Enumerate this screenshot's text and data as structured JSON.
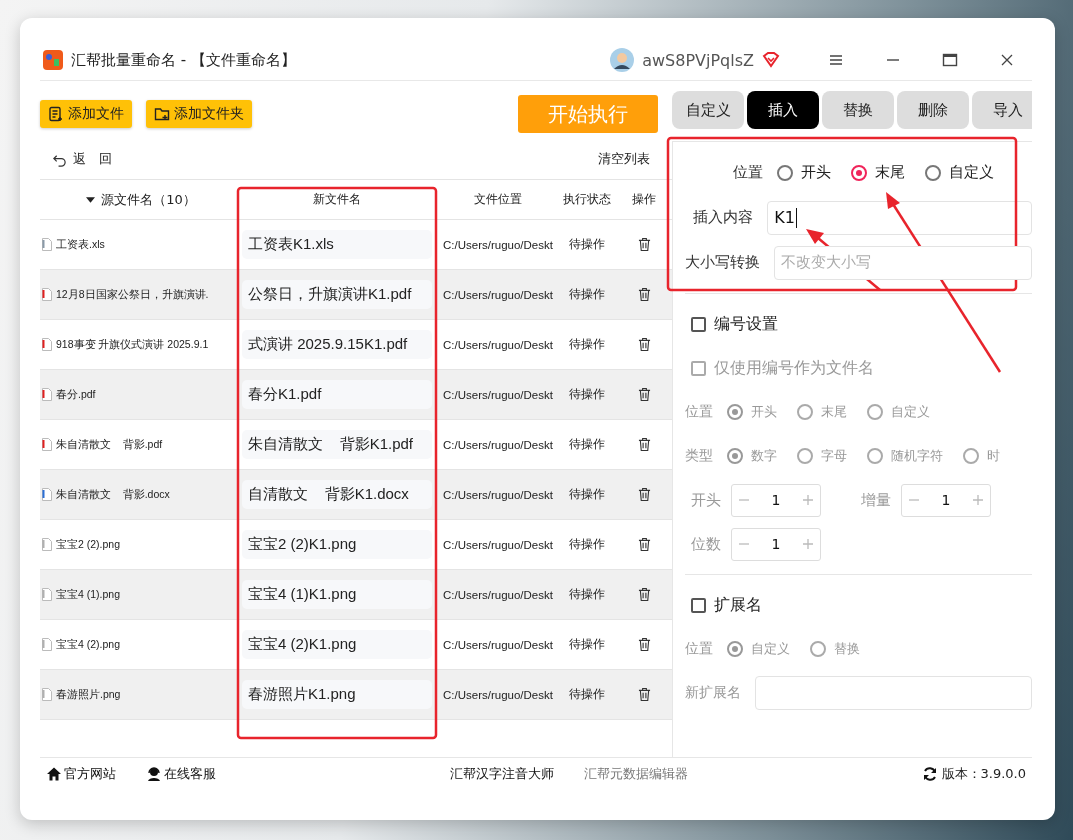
{
  "window": {
    "title": "汇帮批量重命名 - 【文件重命名】",
    "user": "awS8PVjPqlsZ"
  },
  "toolbar": {
    "buttons": [
      {
        "label": "添加文件",
        "kind": "file"
      },
      {
        "label": "添加文件夹",
        "kind": "folder"
      }
    ],
    "start": "开始执行"
  },
  "back": "返　回",
  "clear": "清空列表",
  "table": {
    "columns": [
      "源文件名（10）",
      "新文件名",
      "文件位置",
      "执行状态",
      "操作"
    ],
    "rows": [
      {
        "source": "工资表.xls",
        "new": "工资表K1.xls",
        "location": "C:/Users/ruguo/Deskt",
        "status": "待操作",
        "color": "#8a9aa8"
      },
      {
        "source": "12月8日国家公祭日，升旗演讲.",
        "new": "公祭日，升旗演讲K1.pdf",
        "location": "C:/Users/ruguo/Deskt",
        "status": "待操作",
        "color": "#e02020"
      },
      {
        "source": "918事变 升旗仪式演讲 2025.9.1",
        "new": "式演讲 2025.9.15K1.pdf",
        "location": "C:/Users/ruguo/Deskt",
        "status": "待操作",
        "color": "#e02020"
      },
      {
        "source": "春分.pdf",
        "new": "春分K1.pdf",
        "location": "C:/Users/ruguo/Deskt",
        "status": "待操作",
        "color": "#e02020"
      },
      {
        "source": "朱自清散文    背影.pdf",
        "new": "朱自清散文    背影K1.pdf",
        "location": "C:/Users/ruguo/Deskt",
        "status": "待操作",
        "color": "#e02020"
      },
      {
        "source": "朱自清散文    背影.docx",
        "new": "自清散文    背影K1.docx",
        "location": "C:/Users/ruguo/Deskt",
        "status": "待操作",
        "color": "#2b6fd6"
      },
      {
        "source": "宝宝2 (2).png",
        "new": "宝宝2 (2)K1.png",
        "location": "C:/Users/ruguo/Deskt",
        "status": "待操作",
        "color": "#b0b0b0"
      },
      {
        "source": "宝宝4 (1).png",
        "new": "宝宝4 (1)K1.png",
        "location": "C:/Users/ruguo/Deskt",
        "status": "待操作",
        "color": "#b0b0b0"
      },
      {
        "source": "宝宝4 (2).png",
        "new": "宝宝4 (2)K1.png",
        "location": "C:/Users/ruguo/Deskt",
        "status": "待操作",
        "color": "#b0b0b0"
      },
      {
        "source": "春游照片.png",
        "new": "春游照片K1.png",
        "location": "C:/Users/ruguo/Deskt",
        "status": "待操作",
        "color": "#b0b0b0"
      }
    ]
  },
  "tabs": [
    {
      "label": "自定义",
      "selected": false
    },
    {
      "label": "插入",
      "selected": true
    },
    {
      "label": "替换",
      "selected": false
    },
    {
      "label": "删除",
      "selected": false
    },
    {
      "label": "导入",
      "selected": false
    }
  ],
  "sections": [
    {
      "items": [
        {
          "kind": "radio-group",
          "label": "位置",
          "disabled": false,
          "options": [
            {
              "label": "开头",
              "selected": false
            },
            {
              "label": "末尾",
              "selected": true
            },
            {
              "label": "自定义",
              "selected": false
            }
          ]
        },
        {
          "kind": "input",
          "label": "插入内容",
          "value": "K1",
          "disabled": false
        },
        {
          "kind": "select",
          "label": "大小写转换",
          "placeholder": "不改变大小写"
        }
      ]
    },
    {
      "items": [
        {
          "kind": "checkbox",
          "label": "编号设置",
          "checked": false,
          "disabled": false
        },
        {
          "kind": "checkbox",
          "label": "仅使用编号作为文件名",
          "checked": false,
          "disabled": true
        },
        {
          "kind": "radio-group",
          "label": "位置",
          "disabled": true,
          "options": [
            {
              "label": "开头",
              "selected": true
            },
            {
              "label": "末尾",
              "selected": false
            },
            {
              "label": "自定义",
              "selected": false
            }
          ]
        },
        {
          "kind": "radio-group",
          "label": "类型",
          "disabled": true,
          "options": [
            {
              "label": "数字",
              "selected": true
            },
            {
              "label": "字母",
              "selected": false
            },
            {
              "label": "随机字符",
              "selected": false
            },
            {
              "label": "时",
              "selected": false
            }
          ]
        },
        {
          "kind": "steppers",
          "items": [
            {
              "label": "开头",
              "value": "1"
            },
            {
              "label": "增量",
              "value": "1"
            }
          ]
        },
        {
          "kind": "steppers",
          "items": [
            {
              "label": "位数",
              "value": "1"
            }
          ]
        }
      ]
    },
    {
      "items": [
        {
          "kind": "checkbox",
          "label": "扩展名",
          "checked": false,
          "disabled": false
        },
        {
          "kind": "radio-group",
          "label": "位置",
          "disabled": true,
          "options": [
            {
              "label": "自定义",
              "selected": true
            },
            {
              "label": "替换",
              "selected": false
            }
          ]
        },
        {
          "kind": "input",
          "label": "新扩展名",
          "disabled": true
        }
      ]
    }
  ],
  "footer": {
    "links": [
      {
        "label": "官方网站",
        "kind": "home"
      },
      {
        "label": "在线客服",
        "kind": "support"
      }
    ],
    "apps": [
      {
        "label": "汇帮汉字注音大师",
        "muted": false
      },
      {
        "label": "汇帮元数据编辑器",
        "muted": true
      }
    ],
    "version": "版本：3.9.0.0"
  }
}
